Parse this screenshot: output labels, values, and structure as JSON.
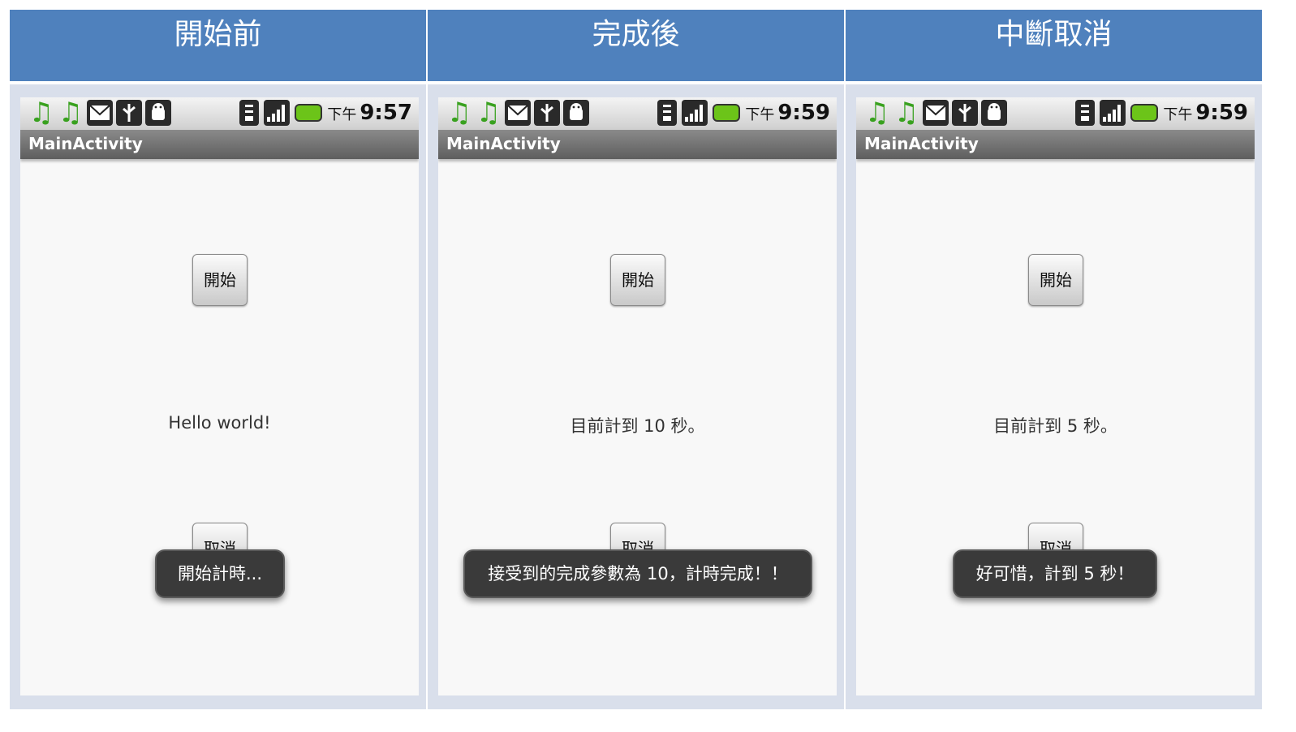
{
  "panels": [
    {
      "header": "開始前",
      "status": {
        "ampm": "下午",
        "time": "9:57"
      },
      "app_title": "MainActivity",
      "start_label": "開始",
      "message": "Hello world!",
      "cancel_label": "取消",
      "toast": "開始計時..."
    },
    {
      "header": "完成後",
      "status": {
        "ampm": "下午",
        "time": "9:59"
      },
      "app_title": "MainActivity",
      "start_label": "開始",
      "message": "目前計到 10 秒。",
      "cancel_label": "取消",
      "toast": "接受到的完成參數為 10，計時完成！！"
    },
    {
      "header": "中斷取消",
      "status": {
        "ampm": "下午",
        "time": "9:59"
      },
      "app_title": "MainActivity",
      "start_label": "開始",
      "message": "目前計到 5 秒。",
      "cancel_label": "取消",
      "toast": "好可惜，計到 5 秒！"
    }
  ],
  "status_icons": [
    "music-icon",
    "music-icon",
    "gmail-icon",
    "usb-icon",
    "android-debug-icon",
    "wifi-icon",
    "signal-icon",
    "battery-icon"
  ],
  "colors": {
    "header_bg": "#4f81bd",
    "panel_bg": "#d9dfeb",
    "battery": "#6cc419",
    "music_note": "#39a11f"
  }
}
